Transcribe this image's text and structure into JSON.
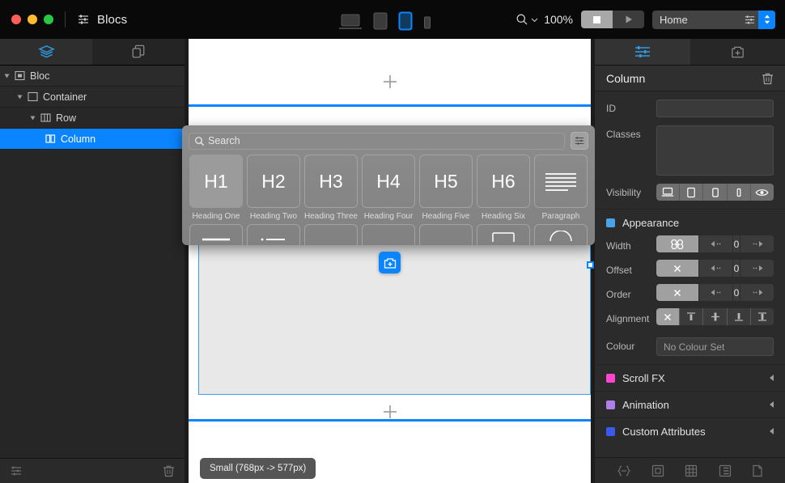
{
  "titlebar": {
    "app_name": "Blocs",
    "logo_icon": "sliders-icon",
    "traffic_lights": [
      "close-button",
      "minimize-button",
      "zoom-button"
    ],
    "devices": [
      {
        "name": "device-laptop",
        "icon": "laptop-icon",
        "selected": false
      },
      {
        "name": "device-tablet-landscape",
        "icon": "tablet-landscape-icon",
        "selected": false
      },
      {
        "name": "device-tablet-portrait",
        "icon": "tablet-portrait-icon",
        "selected": true
      },
      {
        "name": "device-phone",
        "icon": "phone-icon",
        "selected": false
      }
    ],
    "zoom_level": "100%",
    "zoom_icon": "magnifier-icon",
    "preview_stop_icon": "stop-icon",
    "preview_play_icon": "play-icon",
    "page_selector": {
      "value": "Home",
      "settings_icon": "page-settings-icon",
      "stepper_icon": "stepper-up-down-icon"
    },
    "accent_blue": "#0a84ff"
  },
  "left_panel": {
    "tabs": [
      {
        "name": "tab-layers",
        "icon": "layers-icon",
        "active": true
      },
      {
        "name": "tab-pages",
        "icon": "copy-pages-icon",
        "active": false
      }
    ],
    "tree": [
      {
        "label": "Bloc",
        "depth": 0,
        "icon": "bloc-icon",
        "expanded": true,
        "selected": false
      },
      {
        "label": "Container",
        "depth": 1,
        "icon": "container-icon",
        "expanded": true,
        "selected": false
      },
      {
        "label": "Row",
        "depth": 2,
        "icon": "row-icon",
        "expanded": true,
        "selected": false
      },
      {
        "label": "Column",
        "depth": 3,
        "icon": "column-icon",
        "expanded": false,
        "selected": true
      }
    ],
    "bottom_bar": {
      "settings_icon": "sliders-icon",
      "delete_icon": "trash-icon"
    }
  },
  "canvas": {
    "top_add_icon": "plus-icon",
    "bottom_add_icon": "plus-icon",
    "tooltip": "Small (768px -> 577px)",
    "selection_color": "#3aa0f5",
    "divider_color": "#0a84ff"
  },
  "popup": {
    "search_placeholder": "Search",
    "search_icon": "search-icon",
    "filter_icon": "filter-sliders-icon",
    "items": [
      {
        "glyph": "H1",
        "label": "Heading One",
        "highlighted": true
      },
      {
        "glyph": "H2",
        "label": "Heading Two",
        "highlighted": false
      },
      {
        "glyph": "H3",
        "label": "Heading Three",
        "highlighted": false
      },
      {
        "glyph": "H4",
        "label": "Heading Four",
        "highlighted": false
      },
      {
        "glyph": "H5",
        "label": "Heading Five",
        "highlighted": false
      },
      {
        "glyph": "H6",
        "label": "Heading Six",
        "highlighted": false
      },
      {
        "glyph": "",
        "label": "Paragraph",
        "highlighted": false
      }
    ],
    "add_brick_icon": "add-brick-icon"
  },
  "right_panel": {
    "tabs": [
      {
        "name": "tab-attributes",
        "icon": "sliders-icon",
        "active": true
      },
      {
        "name": "tab-add-page",
        "icon": "add-page-icon",
        "active": false
      }
    ],
    "header": {
      "title": "Column",
      "delete_icon": "trash-icon"
    },
    "fields": {
      "id_label": "ID",
      "id_value": "",
      "classes_label": "Classes",
      "classes_value": "",
      "visibility_label": "Visibility",
      "visibility_buttons": [
        {
          "name": "visibility-laptop",
          "icon": "laptop-icon"
        },
        {
          "name": "visibility-tablet",
          "icon": "tablet-icon"
        },
        {
          "name": "visibility-tablet-portrait",
          "icon": "tablet-portrait-icon"
        },
        {
          "name": "visibility-phone",
          "icon": "phone-icon"
        },
        {
          "name": "visibility-eye",
          "icon": "eye-icon"
        }
      ]
    },
    "appearance": {
      "title": "Appearance",
      "swatch_color": "#4aa3e8",
      "width_label": "Width",
      "width_mode_icon": "infinity-icon",
      "width_value": "0",
      "offset_label": "Offset",
      "offset_mode_icon": "x-icon",
      "offset_value": "0",
      "order_label": "Order",
      "order_mode_icon": "x-icon",
      "order_value": "0",
      "alignment_label": "Alignment",
      "alignment_buttons": [
        {
          "name": "align-none",
          "icon": "x-icon",
          "selected": true
        },
        {
          "name": "align-top",
          "icon": "align-top-icon",
          "selected": false
        },
        {
          "name": "align-middle",
          "icon": "align-middle-icon",
          "selected": false
        },
        {
          "name": "align-bottom",
          "icon": "align-bottom-icon",
          "selected": false
        },
        {
          "name": "align-stretch",
          "icon": "align-stretch-icon",
          "selected": false
        }
      ],
      "colour_label": "Colour",
      "colour_value": "No Colour Set"
    },
    "sections": [
      {
        "label": "Scroll FX",
        "color": "#ff44d0",
        "chevron": "chevron-left-icon"
      },
      {
        "label": "Animation",
        "color": "#b07ee8",
        "chevron": "chevron-left-icon"
      },
      {
        "label": "Custom Attributes",
        "color": "#3b58ef",
        "chevron": "chevron-left-icon"
      }
    ],
    "bottom_bar_icons": [
      {
        "name": "code-braces-icon"
      },
      {
        "name": "box-icon"
      },
      {
        "name": "grid-icon"
      },
      {
        "name": "list-icon"
      },
      {
        "name": "document-icon"
      }
    ]
  }
}
